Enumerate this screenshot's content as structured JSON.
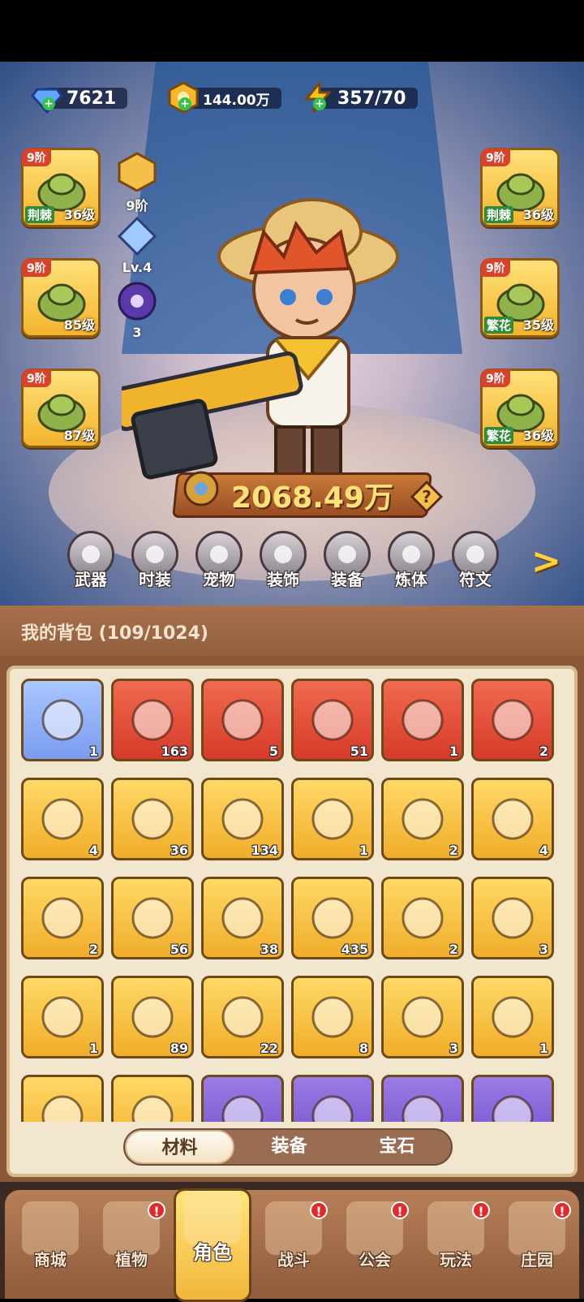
{
  "resources": {
    "diamonds": "7621",
    "coins": "144.00万",
    "energy": "357/70"
  },
  "left_equipment": [
    {
      "stage": "9阶",
      "tag": "荆棘",
      "level": "36级",
      "icon": "hat-icon"
    },
    {
      "stage": "9阶",
      "tag": "",
      "level": "85级",
      "icon": "gloves-icon"
    },
    {
      "stage": "9阶",
      "tag": "",
      "level": "87级",
      "icon": "pants-icon"
    }
  ],
  "right_equipment": [
    {
      "stage": "9阶",
      "tag": "荆棘",
      "level": "36级",
      "icon": "shirt-icon"
    },
    {
      "stage": "9阶",
      "tag": "繁花",
      "level": "35级",
      "icon": "belt-icon"
    },
    {
      "stage": "9阶",
      "tag": "繁花",
      "level": "36级",
      "icon": "boots-icon"
    }
  ],
  "middle_stats": {
    "stage": "9阶",
    "level": "Lv.4",
    "count": "3"
  },
  "power": "2068.49万",
  "category_tabs": [
    "武器",
    "时装",
    "宠物",
    "装饰",
    "装备",
    "炼体",
    "符文"
  ],
  "bag": {
    "title": "我的背包 (109/1024)",
    "items": [
      {
        "color": "blue",
        "count": "1",
        "icon": "duck-flower-icon"
      },
      {
        "color": "red",
        "count": "163",
        "icon": "star-crystal-icon"
      },
      {
        "color": "red",
        "count": "5",
        "icon": "moon-star-icon"
      },
      {
        "color": "red",
        "count": "51",
        "icon": "potion-icon"
      },
      {
        "color": "red",
        "count": "1",
        "icon": "green-tube-icon"
      },
      {
        "color": "red",
        "count": "2",
        "icon": "green-capsule-icon"
      },
      {
        "color": "gold",
        "count": "4",
        "icon": "water-drop-icon"
      },
      {
        "color": "gold",
        "count": "36",
        "icon": "skull-card-icon"
      },
      {
        "color": "gold",
        "count": "134",
        "icon": "duck-coin-icon"
      },
      {
        "color": "gold",
        "count": "1",
        "icon": "ticket-icon"
      },
      {
        "color": "gold",
        "count": "2",
        "icon": "compass-icon"
      },
      {
        "color": "gold",
        "count": "4",
        "icon": "ruby-key-icon"
      },
      {
        "color": "gold",
        "count": "2",
        "icon": "gold-key-icon"
      },
      {
        "color": "gold",
        "count": "56",
        "icon": "pyramid-icon"
      },
      {
        "color": "gold",
        "count": "38",
        "icon": "rune-stone-icon"
      },
      {
        "color": "gold",
        "count": "435",
        "icon": "orange-potion-icon"
      },
      {
        "color": "gold",
        "count": "2",
        "icon": "sand-pile-icon"
      },
      {
        "color": "gold",
        "count": "3",
        "icon": "flower-pot-icon"
      },
      {
        "color": "gold",
        "count": "1",
        "icon": "sprayer-icon"
      },
      {
        "color": "gold",
        "count": "89",
        "icon": "cake-icon"
      },
      {
        "color": "gold",
        "count": "22",
        "icon": "spell-book-icon"
      },
      {
        "color": "gold",
        "count": "8",
        "icon": "can-icon"
      },
      {
        "color": "gold",
        "count": "3",
        "icon": "bird-icon"
      },
      {
        "color": "gold",
        "count": "1",
        "icon": "orange-gem-icon"
      },
      {
        "color": "gold",
        "count": "",
        "icon": "partial-item-icon"
      },
      {
        "color": "gold",
        "count": "",
        "icon": "partial-item-icon"
      },
      {
        "color": "purple",
        "count": "",
        "icon": "partial-item-icon"
      },
      {
        "color": "purple",
        "count": "",
        "icon": "partial-item-icon"
      },
      {
        "color": "purple",
        "count": "",
        "icon": "wrench-icon"
      },
      {
        "color": "purple",
        "count": "",
        "icon": "partial-item-icon"
      }
    ]
  },
  "bag_filter": [
    "材料",
    "装备",
    "宝石"
  ],
  "bottom_nav": [
    {
      "label": "商城",
      "badge": false
    },
    {
      "label": "植物",
      "badge": true
    },
    {
      "label": "角色",
      "badge": false,
      "active": true
    },
    {
      "label": "战斗",
      "badge": true
    },
    {
      "label": "公会",
      "badge": true
    },
    {
      "label": "玩法",
      "badge": true
    },
    {
      "label": "庄园",
      "badge": true
    }
  ],
  "badge_mark": "!"
}
